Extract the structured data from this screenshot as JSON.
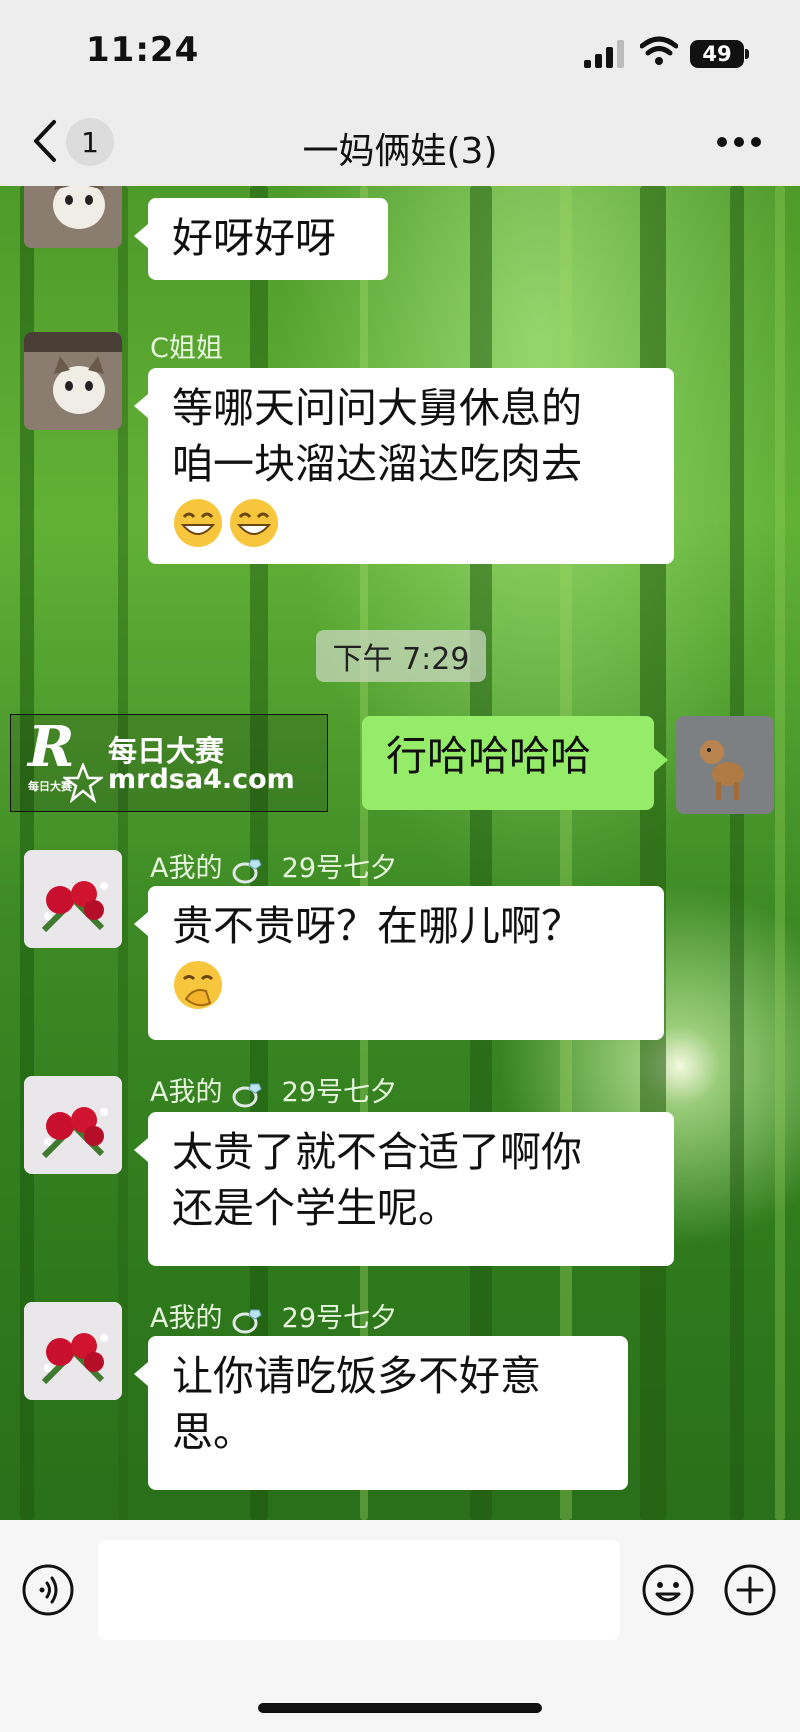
{
  "status_bar": {
    "time": "11:24",
    "battery": "49"
  },
  "nav": {
    "unread_count": "1",
    "title": "一妈俩娃(3)"
  },
  "messages": [
    {
      "side": "left",
      "avatar": "cat-avatar",
      "sender": "",
      "lines": [
        "好呀好呀"
      ]
    },
    {
      "side": "left",
      "avatar": "cat-avatar",
      "sender": "C姐姐",
      "lines": [
        "等哪天问问大舅休息的",
        "咱一块溜达溜达吃肉去"
      ],
      "emoji": [
        "grinning-face-icon",
        "grinning-face-icon"
      ]
    },
    {
      "side": "right",
      "avatar": "dog-avatar",
      "lines": [
        "行哈哈哈哈"
      ]
    },
    {
      "side": "left",
      "avatar": "rose-avatar",
      "sender_prefix": "A我的",
      "sender_suffix": "29号七夕",
      "lines": [
        "贵不贵呀？在哪儿啊？"
      ],
      "emoji": [
        "hand-over-mouth-icon"
      ]
    },
    {
      "side": "left",
      "avatar": "rose-avatar",
      "sender_prefix": "A我的",
      "sender_suffix": "29号七夕",
      "lines": [
        "太贵了就不合适了啊你",
        "还是个学生呢。"
      ]
    },
    {
      "side": "left",
      "avatar": "rose-avatar",
      "sender_prefix": "A我的",
      "sender_suffix": "29号七夕",
      "lines": [
        "让你请吃饭多不好意",
        "思。"
      ]
    }
  ],
  "timestamp": "下午 7:29",
  "watermark": {
    "letter": "R",
    "small": "每日大赛",
    "cn": "每日大赛",
    "url": "mrdsa4.com"
  },
  "icons": {
    "voice": "voice-icon",
    "emoji": "emoji-face-icon",
    "add": "plus-icon",
    "ring": "ring-icon"
  }
}
